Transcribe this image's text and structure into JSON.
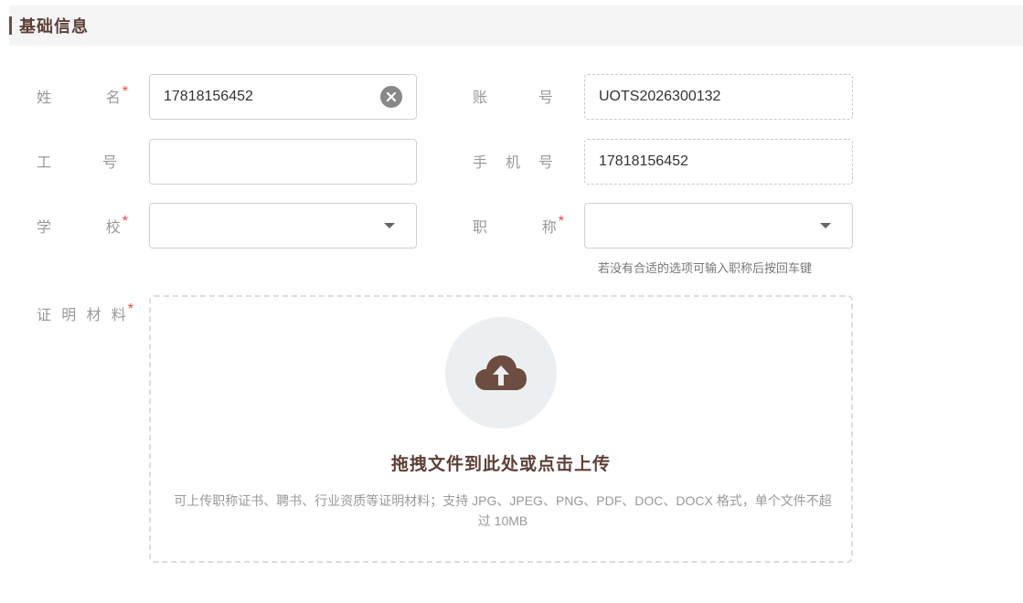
{
  "section": {
    "title": "基础信息"
  },
  "fields": {
    "name": {
      "label_a": "姓",
      "label_b": "名",
      "required": "*",
      "value": "17818156452"
    },
    "account": {
      "label_a": "账",
      "label_b": "号",
      "value": "UOTS2026300132"
    },
    "employee_id": {
      "label_a": "工",
      "label_b": "号",
      "value": ""
    },
    "phone": {
      "label_a": "手",
      "label_b": "机",
      "label_c": "号",
      "value": "17818156452"
    },
    "school": {
      "label_a": "学",
      "label_b": "校",
      "required": "*",
      "value": ""
    },
    "title": {
      "label_a": "职",
      "label_b": "称",
      "required": "*",
      "value": "",
      "hint": "若没有合适的选项可输入职称后按回车键"
    },
    "proof": {
      "label_a": "证",
      "label_b": "明",
      "label_c": "材",
      "label_d": "料",
      "required": "*"
    }
  },
  "upload": {
    "title": "拖拽文件到此处或点击上传",
    "desc": "可上传职称证书、聘书、行业资质等证明材料；支持 JPG、JPEG、PNG、PDF、DOC、DOCX 格式，单个文件不超过 10MB",
    "icon": "cloud-upload-icon"
  },
  "colors": {
    "accent": "#5d4037",
    "required": "#f44336"
  }
}
